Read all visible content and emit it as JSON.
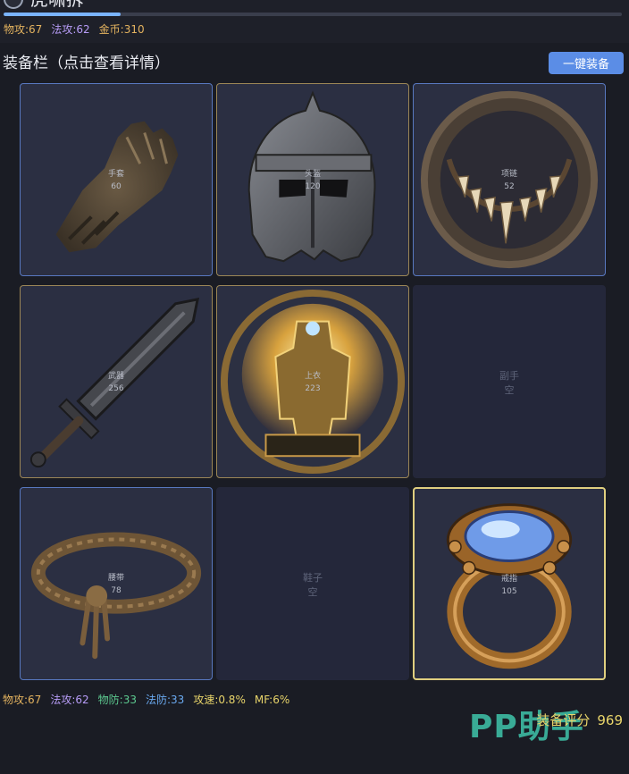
{
  "header": {
    "title": "虎啸拆",
    "progress": 0.19
  },
  "top_stats": {
    "phys_atk": "物攻:67",
    "mag_atk": "法攻:62",
    "gold": "金币:310"
  },
  "equipment": {
    "section_title": "装备栏（点击查看详情）",
    "equip_all_label": "一键装备",
    "slots": [
      {
        "name": "手套",
        "score": "60",
        "item": "leather-glove",
        "rarity": "rare"
      },
      {
        "name": "头盔",
        "score": "120",
        "item": "iron-helmet",
        "rarity": "epic"
      },
      {
        "name": "项链",
        "score": "52",
        "item": "fang-necklace",
        "rarity": "rare"
      },
      {
        "name": "武器",
        "score": "256",
        "item": "iron-greatsword",
        "rarity": "epic"
      },
      {
        "name": "上衣",
        "score": "223",
        "item": "golden-armor",
        "rarity": "epic"
      },
      {
        "name": "副手",
        "score": "空",
        "item": "",
        "rarity": "empty"
      },
      {
        "name": "腰带",
        "score": "78",
        "item": "rope-belt",
        "rarity": "rare"
      },
      {
        "name": "鞋子",
        "score": "空",
        "item": "",
        "rarity": "empty"
      },
      {
        "name": "戒指",
        "score": "105",
        "item": "sapphire-ring",
        "rarity": "legendary"
      }
    ]
  },
  "bottom_stats": {
    "phys_atk": "物攻:67",
    "mag_atk": "法攻:62",
    "phys_def": "物防:33",
    "mag_def": "法防:33",
    "atk_speed": "攻速:0.8%",
    "mf": "MF:6%"
  },
  "score": {
    "label": "装备评分",
    "value": "969"
  },
  "watermark": "PP助手",
  "colors": {
    "accent": "#5b8de6",
    "rare_border": "#5878c0",
    "epic_border": "#9b8656",
    "legendary_border": "#e0cf7f"
  }
}
